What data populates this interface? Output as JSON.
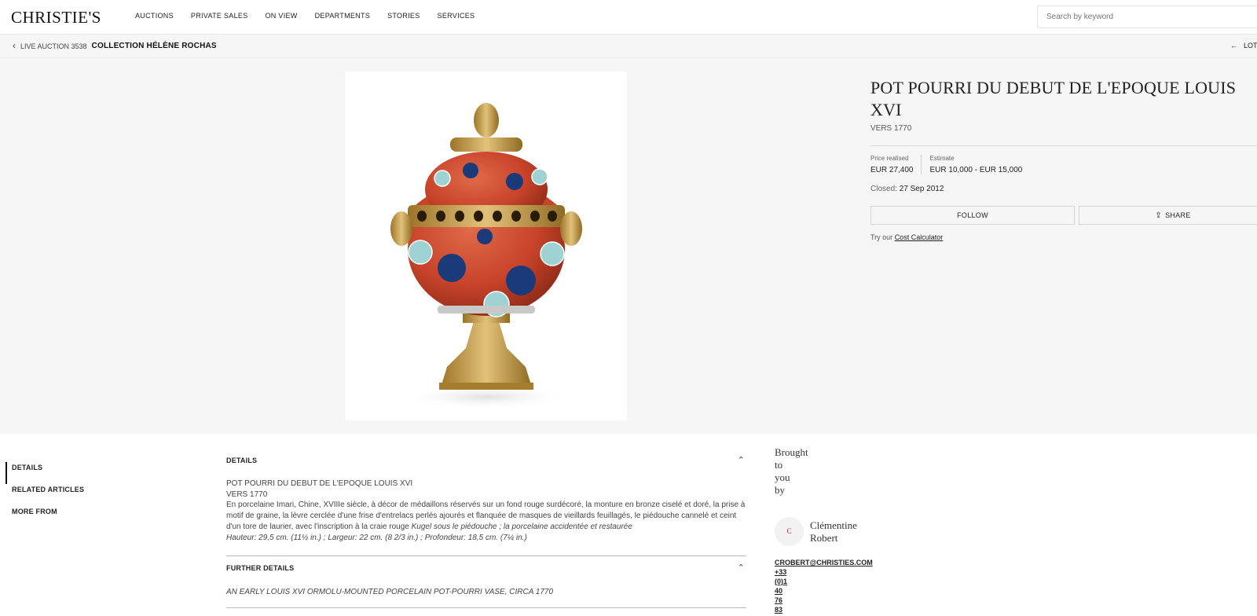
{
  "header": {
    "logo": "CHRISTIE'S",
    "nav": [
      "AUCTIONS",
      "PRIVATE SALES",
      "ON VIEW",
      "DEPARTMENTS",
      "STORIES",
      "SERVICES"
    ],
    "search_placeholder": "Search by keyword"
  },
  "breadcrumb": {
    "prefix": "LIVE AUCTION 3538",
    "sale": "COLLECTION HÉLÈNE ROCHAS",
    "lots_label": "LOT"
  },
  "lot": {
    "title": "POT POURRI DU DEBUT DE L'EPOQUE LOUIS XVI",
    "subtitle": "VERS 1770",
    "price_label": "Price realised",
    "price": "EUR 27,400",
    "estimate_label": "Estimate",
    "estimate": "EUR 10,000 - EUR 15,000",
    "closed_label": "Closed:",
    "closed_date": "27 Sep 2012",
    "follow": "FOLLOW",
    "share": "SHARE",
    "calc_prefix": "Try our",
    "calc_link": "Cost Calculator"
  },
  "side_nav": [
    "DETAILS",
    "RELATED ARTICLES",
    "MORE FROM"
  ],
  "details": {
    "heading": "DETAILS",
    "line1": "POT POURRI DU DEBUT DE L'EPOQUE LOUIS XVI",
    "line2": "VERS 1770",
    "body": "En porcelaine Imari, Chine, XVIIIe siècle, à décor de médaillons réservés sur un fond rouge surdécoré, la monture en bronze ciselé et doré, la prise à motif de graine, la lèvre cerclée d'une frise d'entrelacs perlés ajourés et flanquée de masques de vieillards feuillagés, le piédouche cannelé et ceint d'un tore de laurier, avec l'inscription à la craie rouge",
    "body_italic": "Kugel sous le piédouche ; la porcelaine accidentée et restaurée",
    "dims": "Hauteur: 29,5 cm. (11½ in.) ; Largeur: 22 cm. (8 2/3 in.) ; Profondeur: 18,5 cm. (7¼ in.)",
    "further_heading": "FURTHER DETAILS",
    "further_text": "AN EARLY LOUIS XVI ORMOLU-MOUNTED PORCELAIN POT-POURRI VASE, CIRCA 1770"
  },
  "specialist": {
    "brought": [
      "Brought",
      "to",
      "you",
      "by"
    ],
    "initial": "C",
    "name_first": "Clémentine",
    "name_last": "Robert",
    "contact": [
      "CROBERT@CHRISTIES.COM",
      "+33",
      "(0)1",
      "40",
      "76",
      "83"
    ]
  },
  "icons": [
    "chevron-left-icon",
    "arrow-left-icon",
    "share-icon",
    "chevron-up-icon"
  ],
  "colors": {
    "background": "#f6f6f6",
    "vase_red": "#c8432a",
    "cobalt": "#1b3a7a",
    "ormolu": "#c9a24a"
  }
}
